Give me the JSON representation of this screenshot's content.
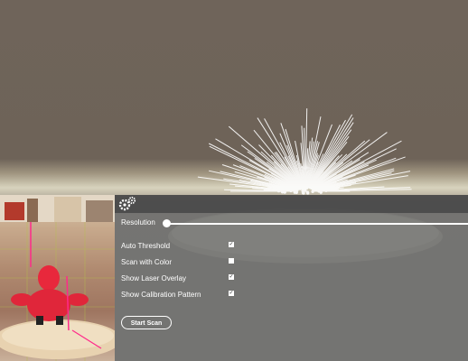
{
  "settings": {
    "resolution_label": "Resolution",
    "resolution_value": 0.02,
    "options": [
      {
        "label": "Auto Threshold",
        "checked": true
      },
      {
        "label": "Scan with Color",
        "checked": false
      },
      {
        "label": "Show Laser Overlay",
        "checked": true
      },
      {
        "label": "Show Calibration Pattern",
        "checked": true
      }
    ],
    "start_label": "Start Scan",
    "gear_icon": "gear-icon"
  },
  "viewport": {
    "point_cloud": "scanned-point-cloud",
    "turntable": "turntable-platform"
  },
  "camera": {
    "feed": "camera-preview"
  }
}
